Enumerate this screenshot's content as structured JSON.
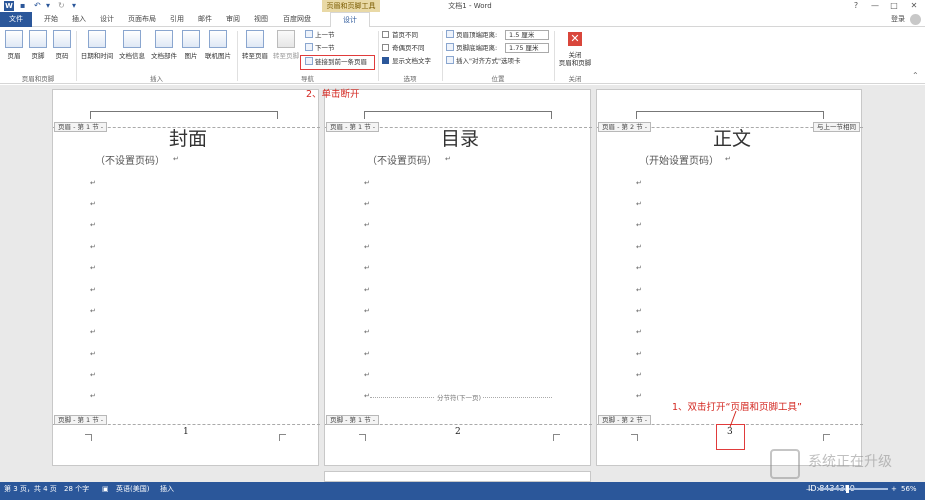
{
  "titlebar": {
    "logo": "W",
    "ctx_group": "页眉和页脚工具",
    "title": "文档1 - Word",
    "help": "?",
    "min": "—",
    "max": "□",
    "close": "✕"
  },
  "tabs": {
    "file": "文件",
    "items": [
      "开始",
      "插入",
      "设计",
      "页面布局",
      "引用",
      "邮件",
      "审阅",
      "视图",
      "百度网盘"
    ],
    "design": "设计",
    "login": "登录"
  },
  "ribbon": {
    "header": "页眉",
    "footer": "页脚",
    "page_number": "页码",
    "group_hf": "页眉和页脚",
    "datetime": "日期和时间",
    "docinfo": "文档信息",
    "docparts": "文档部件",
    "picture": "图片",
    "online_picture": "联机图片",
    "group_insert": "插入",
    "goto_header": "转至页眉",
    "goto_footer": "转至页脚",
    "prev_section": "上一节",
    "next_section": "下一节",
    "link_previous": "链接到前一条页眉",
    "group_nav": "导航",
    "diff_first": "首页不同",
    "diff_odd_even": "奇偶页不同",
    "show_doc_text": "显示文档文字",
    "group_options": "选项",
    "header_top_label": "页眉顶端距离:",
    "header_top_value": "1.5 厘米",
    "footer_bottom_label": "页脚底端距离:",
    "footer_bottom_value": "1.75 厘米",
    "insert_align_tab": "插入\"对齐方式\"选项卡",
    "group_position": "位置",
    "close_label": "关闭\n页眉和页脚",
    "group_close": "关闭"
  },
  "annotations": {
    "step2": "2、单击断开",
    "step1": "1、双击打开“页眉和页脚工具”"
  },
  "pages": [
    {
      "header_tag": "页眉 - 第 1 节 -",
      "title": "封面",
      "subtitle": "（不设置页码）",
      "footer_tag": "页脚 - 第 1 节 -",
      "page_number": "1"
    },
    {
      "header_tag": "页眉 - 第 1 节 -",
      "title": "目录",
      "subtitle": "（不设置页码）",
      "section_break": "分节符(下一页)",
      "footer_tag": "页脚 - 第 1 节 -",
      "page_number": "2"
    },
    {
      "header_tag": "页眉 - 第 2 节 -",
      "same_as_prev": "与上一节相同",
      "title": "正文",
      "subtitle": "（开始设置页码）",
      "footer_tag": "页脚 - 第 2 节 -",
      "page_number": "3"
    }
  ],
  "para_mark": "↵",
  "status": {
    "page": "第 3 页，共 4 页",
    "words": "28 个字",
    "language": "英语(美国)",
    "mode": "插入",
    "zoom": "56%"
  },
  "watermark": {
    "line1": "系统正在升级",
    "line2": "ID:8434350"
  },
  "colors": {
    "word_blue": "#2b579a",
    "annotation_red": "#d3261f",
    "context_tab": "#e9d9a6"
  }
}
